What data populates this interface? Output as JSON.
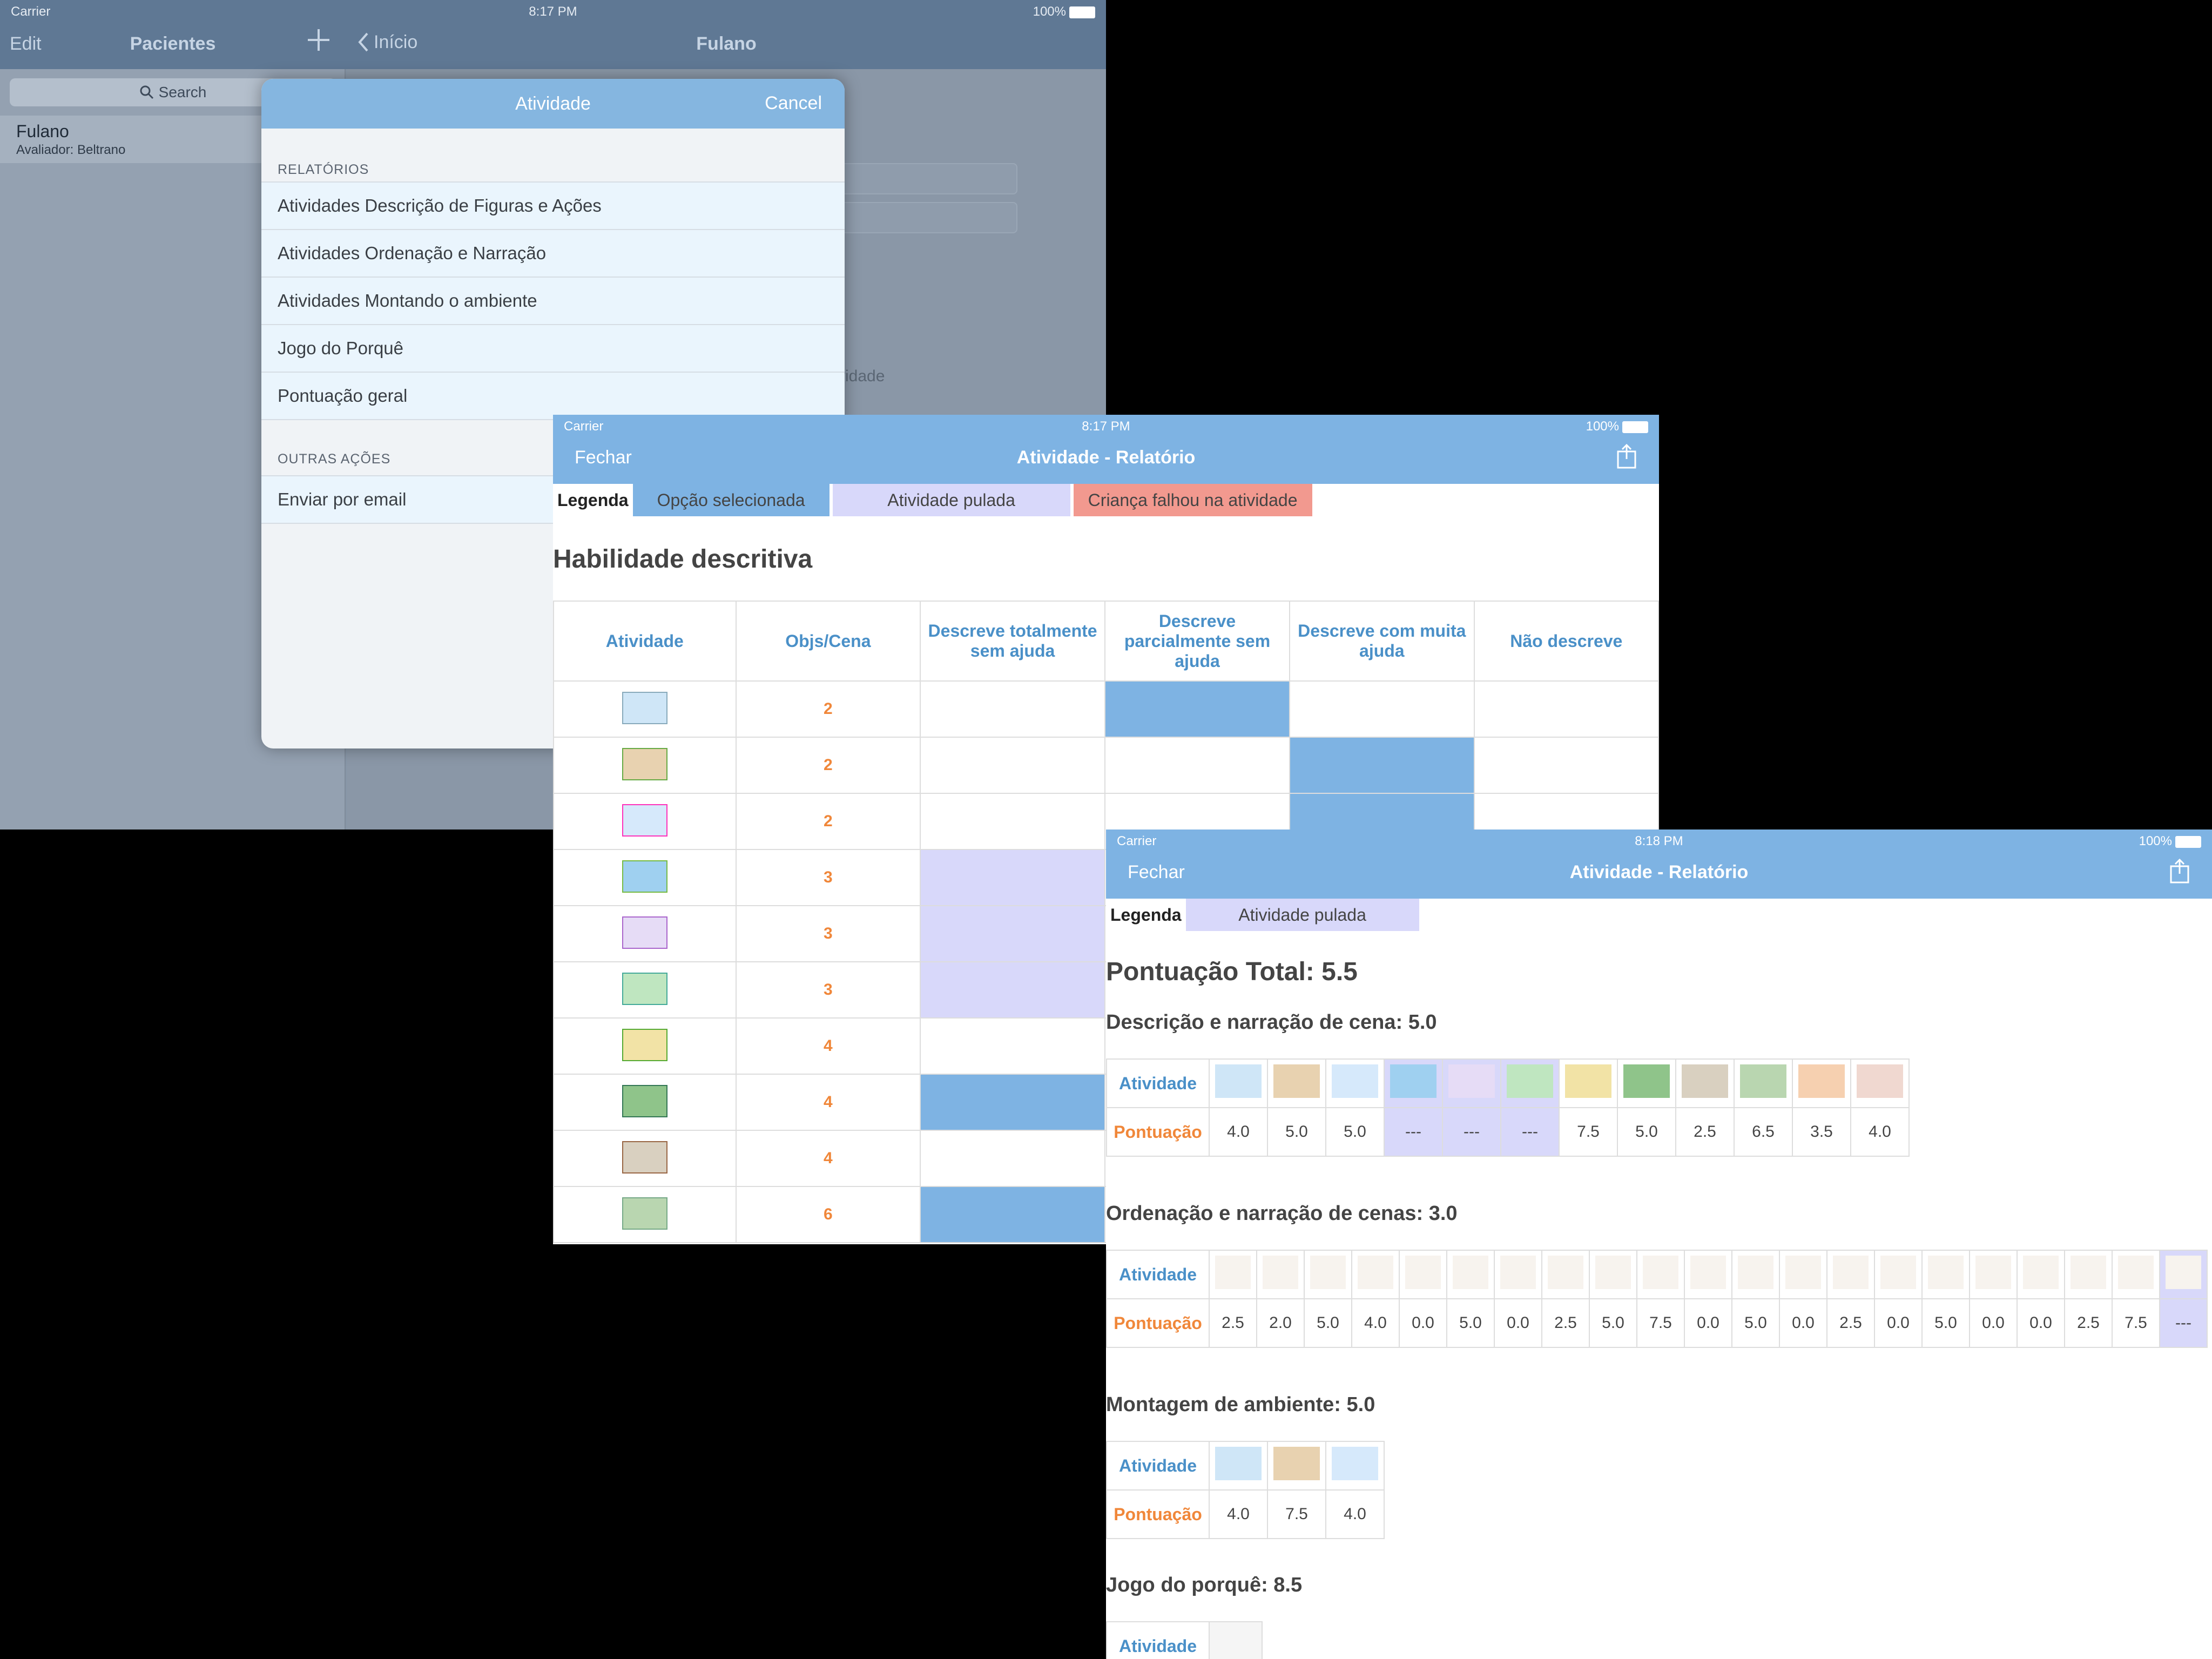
{
  "screen1": {
    "status": {
      "carrier": "Carrier",
      "time": "8:17 PM",
      "battery": "100%"
    },
    "master": {
      "edit": "Edit",
      "title": "Pacientes",
      "search_placeholder": "Search",
      "patient": {
        "name": "Fulano",
        "subtitle": "Avaliador: Beltrano"
      }
    },
    "detail": {
      "back": "Início",
      "title": "Fulano",
      "partial_text": "vidade"
    },
    "popover": {
      "title": "Atividade",
      "cancel": "Cancel",
      "section1": "RELATÓRIOS",
      "items": [
        "Atividades Descrição de Figuras e Ações",
        "Atividades Ordenação e Narração",
        "Atividades Montando o ambiente",
        "Jogo do Porquê",
        "Pontuação geral"
      ],
      "section2": "OUTRAS AÇÕES",
      "items2": [
        "Enviar por email"
      ]
    }
  },
  "screen2": {
    "status": {
      "carrier": "Carrier",
      "time": "8:17 PM",
      "battery": "100%"
    },
    "nav": {
      "close": "Fechar",
      "title": "Atividade - Relatório"
    },
    "legend": {
      "label": "Legenda",
      "selected": "Opção selecionada",
      "skipped": "Atividade pulada",
      "failed": "Criança falhou na atividade",
      "colors": {
        "selected": "#7eb3e3",
        "skipped": "#d8d8fa",
        "failed": "#f2998f"
      }
    },
    "heading": "Habilidade descritiva",
    "columns": [
      "Atividade",
      "Objs/Cena",
      "Descreve totalmente sem ajuda",
      "Descreve parcialmente sem ajuda",
      "Descreve com muita ajuda",
      "Não descreve"
    ],
    "rows": [
      {
        "objs": "2",
        "mark": "partial"
      },
      {
        "objs": "2",
        "mark": "muita"
      },
      {
        "objs": "2",
        "mark": "muita"
      },
      {
        "objs": "3",
        "mark": "skip"
      },
      {
        "objs": "3",
        "mark": "skip"
      },
      {
        "objs": "3",
        "mark": "skip"
      },
      {
        "objs": "4",
        "mark": "none"
      },
      {
        "objs": "4",
        "mark": "total"
      },
      {
        "objs": "4",
        "mark": "none"
      },
      {
        "objs": "6",
        "mark": "total"
      }
    ]
  },
  "screen3": {
    "status": {
      "carrier": "Carrier",
      "time": "8:18 PM",
      "battery": "100%"
    },
    "nav": {
      "close": "Fechar",
      "title": "Atividade - Relatório"
    },
    "legend": {
      "label": "Legenda",
      "skipped": "Atividade pulada"
    },
    "total": "Pontuação Total: 5.5",
    "row_labels": {
      "activity": "Atividade",
      "score": "Pontuação"
    },
    "sections": [
      {
        "title": "Descrição e narração de cena: 5.0",
        "scores": [
          "4.0",
          "5.0",
          "5.0",
          "---",
          "---",
          "---",
          "7.5",
          "5.0",
          "2.5",
          "6.5",
          "3.5",
          "4.0"
        ]
      },
      {
        "title": "Ordenação e narração de cenas: 3.0",
        "scores": [
          "2.5",
          "2.0",
          "5.0",
          "4.0",
          "0.0",
          "5.0",
          "0.0",
          "2.5",
          "5.0",
          "7.5",
          "0.0",
          "5.0",
          "0.0",
          "2.5",
          "0.0",
          "5.0",
          "0.0",
          "0.0",
          "2.5",
          "7.5",
          "---"
        ]
      },
      {
        "title": "Montagem de ambiente: 5.0",
        "scores": [
          "4.0",
          "7.5",
          "4.0"
        ]
      },
      {
        "title": "Jogo do porquê: 8.5",
        "scores": []
      }
    ]
  }
}
